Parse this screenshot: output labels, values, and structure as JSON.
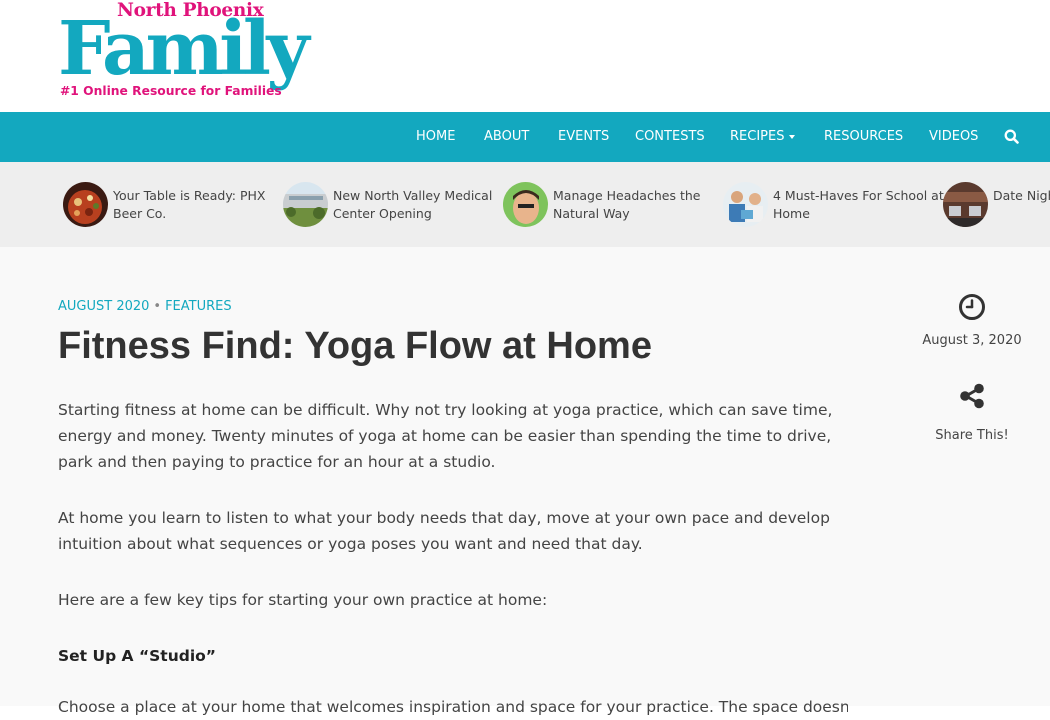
{
  "site": {
    "logo_top": "North Phoenix",
    "logo_main": "Family",
    "logo_tagline": "#1 Online Resource for Families"
  },
  "nav": {
    "items": [
      "HOME",
      "ABOUT",
      "EVENTS",
      "CONTESTS",
      "RECIPES",
      "RESOURCES",
      "VIDEOS"
    ],
    "search_icon": "search-icon"
  },
  "ticker": [
    {
      "title": "Your Table is Ready: PHX Beer Co."
    },
    {
      "title": "New North Valley Medical Center Opening"
    },
    {
      "title": "Manage Headaches the Natural Way"
    },
    {
      "title": "4 Must-Haves For School at Home"
    },
    {
      "title": "Date Night: Perfect Pizza"
    }
  ],
  "article": {
    "date_link": "AUGUST 2020",
    "category_link": "FEATURES",
    "title": "Fitness Find: Yoga Flow at Home",
    "paragraphs": [
      "Starting fitness at home can be difficult. Why not try looking at yoga practice, which can save time, energy and money. Twenty minutes of yoga at home can be easier than spending the time to drive, park and then paying to practice for an hour at a studio.",
      "At home you learn to listen to what your body needs that day, move at your own pace and develop intuition about what sequences or yoga poses you want and need that day.",
      "Here are a few key tips for starting your own practice at home:"
    ],
    "subheading": "Set Up A “Studio”",
    "next_paragraph_start": "Choose a place at your  home that welcomes  inspiration and space for your practice. The space doesn't have to be"
  },
  "sidebar": {
    "date": "August 3, 2020",
    "share_label": "Share This!"
  },
  "colors": {
    "brand_teal": "#13a8bf",
    "brand_pink": "#e0137b"
  }
}
